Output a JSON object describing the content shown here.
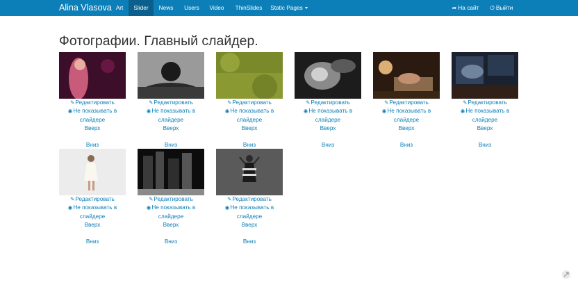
{
  "navbar": {
    "brand": "Alina Vlasova",
    "items": [
      {
        "label": "Art",
        "active": false
      },
      {
        "label": "Slider",
        "active": true
      },
      {
        "label": "News",
        "active": false
      },
      {
        "label": "Users",
        "active": false
      },
      {
        "label": "Video",
        "active": false
      },
      {
        "label": "ThinSlides",
        "active": false
      },
      {
        "label": "Static Pages",
        "active": false
      }
    ],
    "to_site": "На сайт",
    "logout": "Выйти"
  },
  "page": {
    "title": "Фотографии. Главный слайдер."
  },
  "photo_actions": {
    "edit": "Редактировать",
    "hide_line1": "Не показывать в",
    "hide_line2": "слайдере",
    "up": "Вверх",
    "down": "Вниз"
  },
  "photos": [
    {
      "subject": "woman-pink-light"
    },
    {
      "subject": "man-peeking-bw"
    },
    {
      "subject": "grass-field"
    },
    {
      "subject": "woman-lying-bw"
    },
    {
      "subject": "woman-on-sofa"
    },
    {
      "subject": "cafe-window"
    },
    {
      "subject": "girl-white-dress"
    },
    {
      "subject": "city-night"
    },
    {
      "subject": "woman-striped-dress"
    }
  ],
  "colors": {
    "navbar": "#0d7fb8",
    "navbar_active": "#0a5f8c",
    "link": "#0d7fb8"
  }
}
